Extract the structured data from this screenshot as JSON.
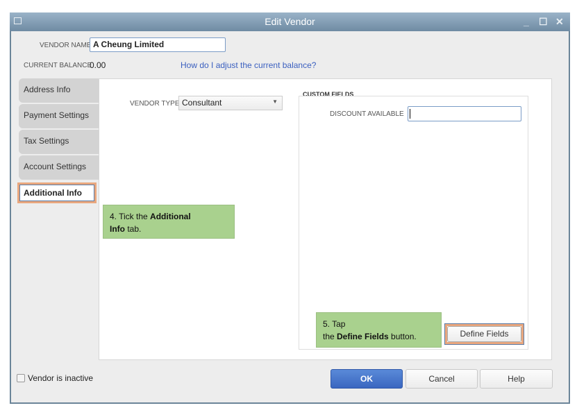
{
  "window": {
    "title": "Edit Vendor"
  },
  "vendor_name": {
    "label": "VENDOR NAME",
    "value": "A Cheung Limited"
  },
  "balance": {
    "label": "CURRENT BALANCE",
    "value": "0.00",
    "help_link": "How do I adjust the current balance?"
  },
  "tabs": [
    {
      "label": "Address Info"
    },
    {
      "label": "Payment Settings"
    },
    {
      "label": "Tax Settings"
    },
    {
      "label": "Account Settings"
    },
    {
      "label": "Additional Info",
      "active": true
    }
  ],
  "vendor_type": {
    "label": "VENDOR TYPE",
    "value": "Consultant"
  },
  "custom_fields": {
    "heading": "CUSTOM FIELDS",
    "fields": [
      {
        "label": "DISCOUNT AVAILABLE",
        "value": ""
      }
    ],
    "define_button": "Define Fields"
  },
  "callouts": {
    "step4": {
      "prefix": "4. Tick the ",
      "bold1": "Additional",
      "bold2": "Info",
      "suffix": " tab."
    },
    "step5": {
      "line1": "5. Tap",
      "prefix": "the ",
      "bold": "Define Fields",
      "suffix": " button."
    }
  },
  "inactive": {
    "label": "Vendor is inactive",
    "checked": false
  },
  "buttons": {
    "ok": "OK",
    "cancel": "Cancel",
    "help": "Help"
  },
  "colors": {
    "accent": "#3f6fc7",
    "highlight": "#e9a77e",
    "callout": "#a9d18e"
  }
}
